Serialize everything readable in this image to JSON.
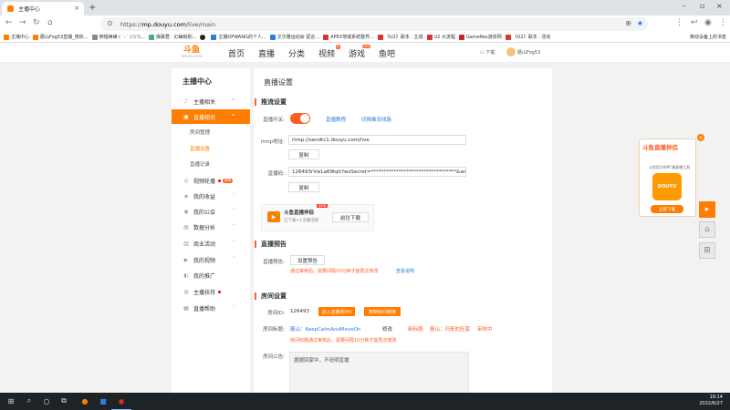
{
  "browser": {
    "tab_title": "主播中心",
    "url_scheme": "https://",
    "url_host": "mp.douyu.com",
    "url_path": "/live/main",
    "new_tab": "+",
    "bookmarks": [
      "主播中心",
      "蘑山Fog53直播_傍依...",
      "倒错峥嵘 ( ˙-˙ )つつ...",
      "弹幕君 · 幻幽呦别...",
      "",
      "主播DPWANG的个人...",
      "文尔雅运动会 留言...",
      "APEX地域系统整界...",
      "《U2》歌本 · 主城",
      "U2 大流程",
      "GameRes游资网",
      "《U2》歌本 · 活动"
    ],
    "bookmark_right": "移动设备上的书签"
  },
  "site": {
    "logo_text": "斗鱼",
    "logo_sub": "DOUYU.COM",
    "nav": [
      {
        "label": "首页",
        "badge": ""
      },
      {
        "label": "直播",
        "badge": ""
      },
      {
        "label": "分类",
        "badge": ""
      },
      {
        "label": "视频",
        "badge": "热"
      },
      {
        "label": "游戏",
        "badge": "new"
      },
      {
        "label": "鱼吧",
        "badge": ""
      }
    ],
    "download": "下载",
    "username": "蘑山Fog53"
  },
  "sidebar": {
    "title": "主播中心",
    "items": [
      {
        "label": "主播相关",
        "icon": "♪"
      },
      {
        "label": "直播相关",
        "icon": "▣"
      },
      {
        "label": "房间管理",
        "icon": ""
      },
      {
        "label": "直播设置",
        "icon": ""
      },
      {
        "label": "直播记录",
        "icon": ""
      },
      {
        "label": "视频轮播",
        "icon": "◎",
        "badge": "新版"
      },
      {
        "label": "我的收益",
        "icon": "◈"
      },
      {
        "label": "我的公会",
        "icon": "◉"
      },
      {
        "label": "数据分析",
        "icon": "▤"
      },
      {
        "label": "商业活动",
        "icon": "▥"
      },
      {
        "label": "我的视频",
        "icon": "▶"
      },
      {
        "label": "我的推广",
        "icon": "◐"
      },
      {
        "label": "主播扶持",
        "icon": "◍"
      },
      {
        "label": "直播帮助",
        "icon": "▦"
      }
    ]
  },
  "main": {
    "page_title": "直播设置",
    "push": {
      "title": "推流设置",
      "switch_label": "直播开关:",
      "tutorial_link": "直播教程",
      "switch_line_link": "切换推流线路",
      "rtmp_label": "rtmp地址:",
      "rtmp_value": "rtmp://sendtc1.douyu.com/live",
      "copy": "复制",
      "code_label": "直播码:",
      "code_value": "126493rVwLa69tqh?wsSecret=**********************************&wsTi",
      "copy2": "复制"
    },
    "promo": {
      "title": "斗鱼直播伴侣",
      "badge": "NEW",
      "sub": "已下载+1次播活跃",
      "button": "前往下载"
    },
    "preview": {
      "title": "直播预告",
      "label": "直播预告:",
      "button": "设置预告",
      "warn": "通过审核后，需要间隔10分钟才能再次修改",
      "link": "查看说明"
    },
    "room": {
      "title": "房间设置",
      "id_label": "房间ID:",
      "id_value": "126493",
      "enter_btn": "进入直播间(H)",
      "copy_btn": "复制房间链接",
      "title_label": "房间标题:",
      "title_value": "蘑山：KeepCalmAndMoveOn",
      "modify": "修改",
      "new_title_label": "新标题:",
      "new_title_value": "蘑山：归来的狂莫",
      "review": "审核中",
      "warn": "房间标题通过审核后，需要间隔10分钟才能再次修改",
      "notice_label": "房间公告:",
      "notice_value": "据据回家中，不说明直播"
    }
  },
  "ad": {
    "title": "斗鱼直播伴侣",
    "sub": "斗鱼官方的PC端直播工具",
    "logo": "DOUYU",
    "button": "立即下载"
  },
  "taskbar": {
    "time": "19:14",
    "date": "2022/6/27"
  }
}
